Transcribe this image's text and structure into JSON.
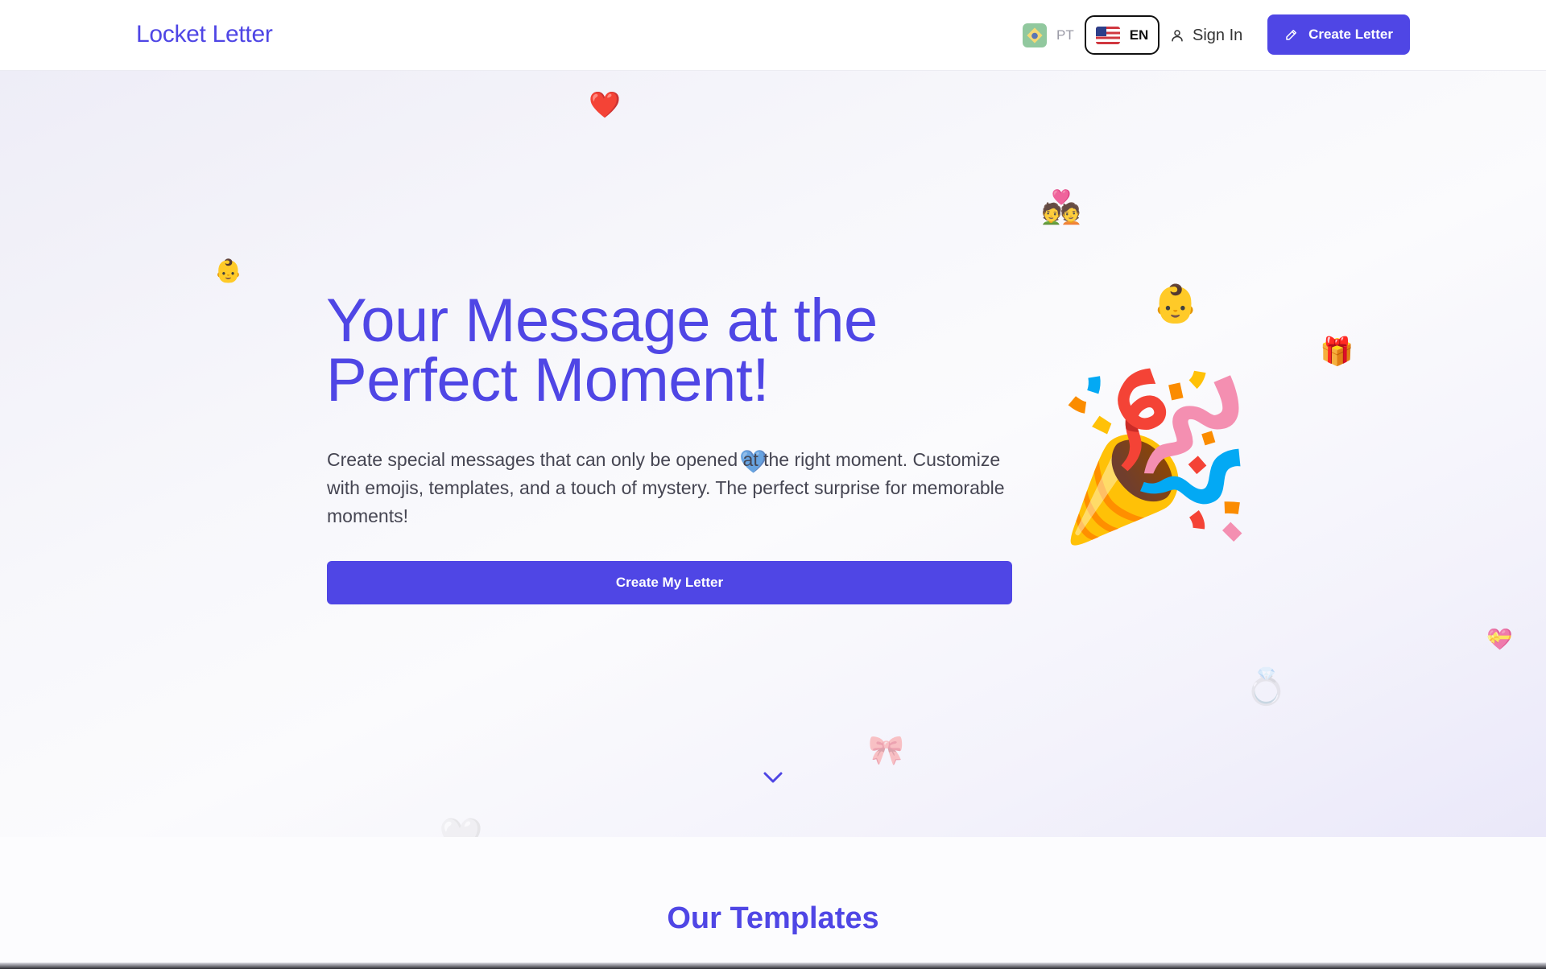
{
  "header": {
    "logo": "Locket Letter",
    "lang_pt": "PT",
    "lang_en": "EN",
    "sign_in": "Sign In",
    "create_letter": "Create Letter"
  },
  "hero": {
    "title_line1": "Your Message at the",
    "title_line2": "Perfect Moment!",
    "subtitle": "Create special messages that can only be opened at the right moment. Customize with emojis, templates, and a touch of mystery. The perfect surprise for memorable moments!",
    "cta": "Create My Letter"
  },
  "decorations": {
    "heart": "❤️",
    "couple": "💑",
    "baby": "👶",
    "baby_large": "👶",
    "gift": "🎁",
    "party_popper": "🎉",
    "heart_ribbon": "💝",
    "ring": "💍",
    "bow": "🎀",
    "blue_heart": "💙",
    "faded": "🤍"
  },
  "sections": {
    "templates_title": "Our Templates"
  },
  "colors": {
    "accent": "#4f46e5",
    "text": "#454552"
  }
}
